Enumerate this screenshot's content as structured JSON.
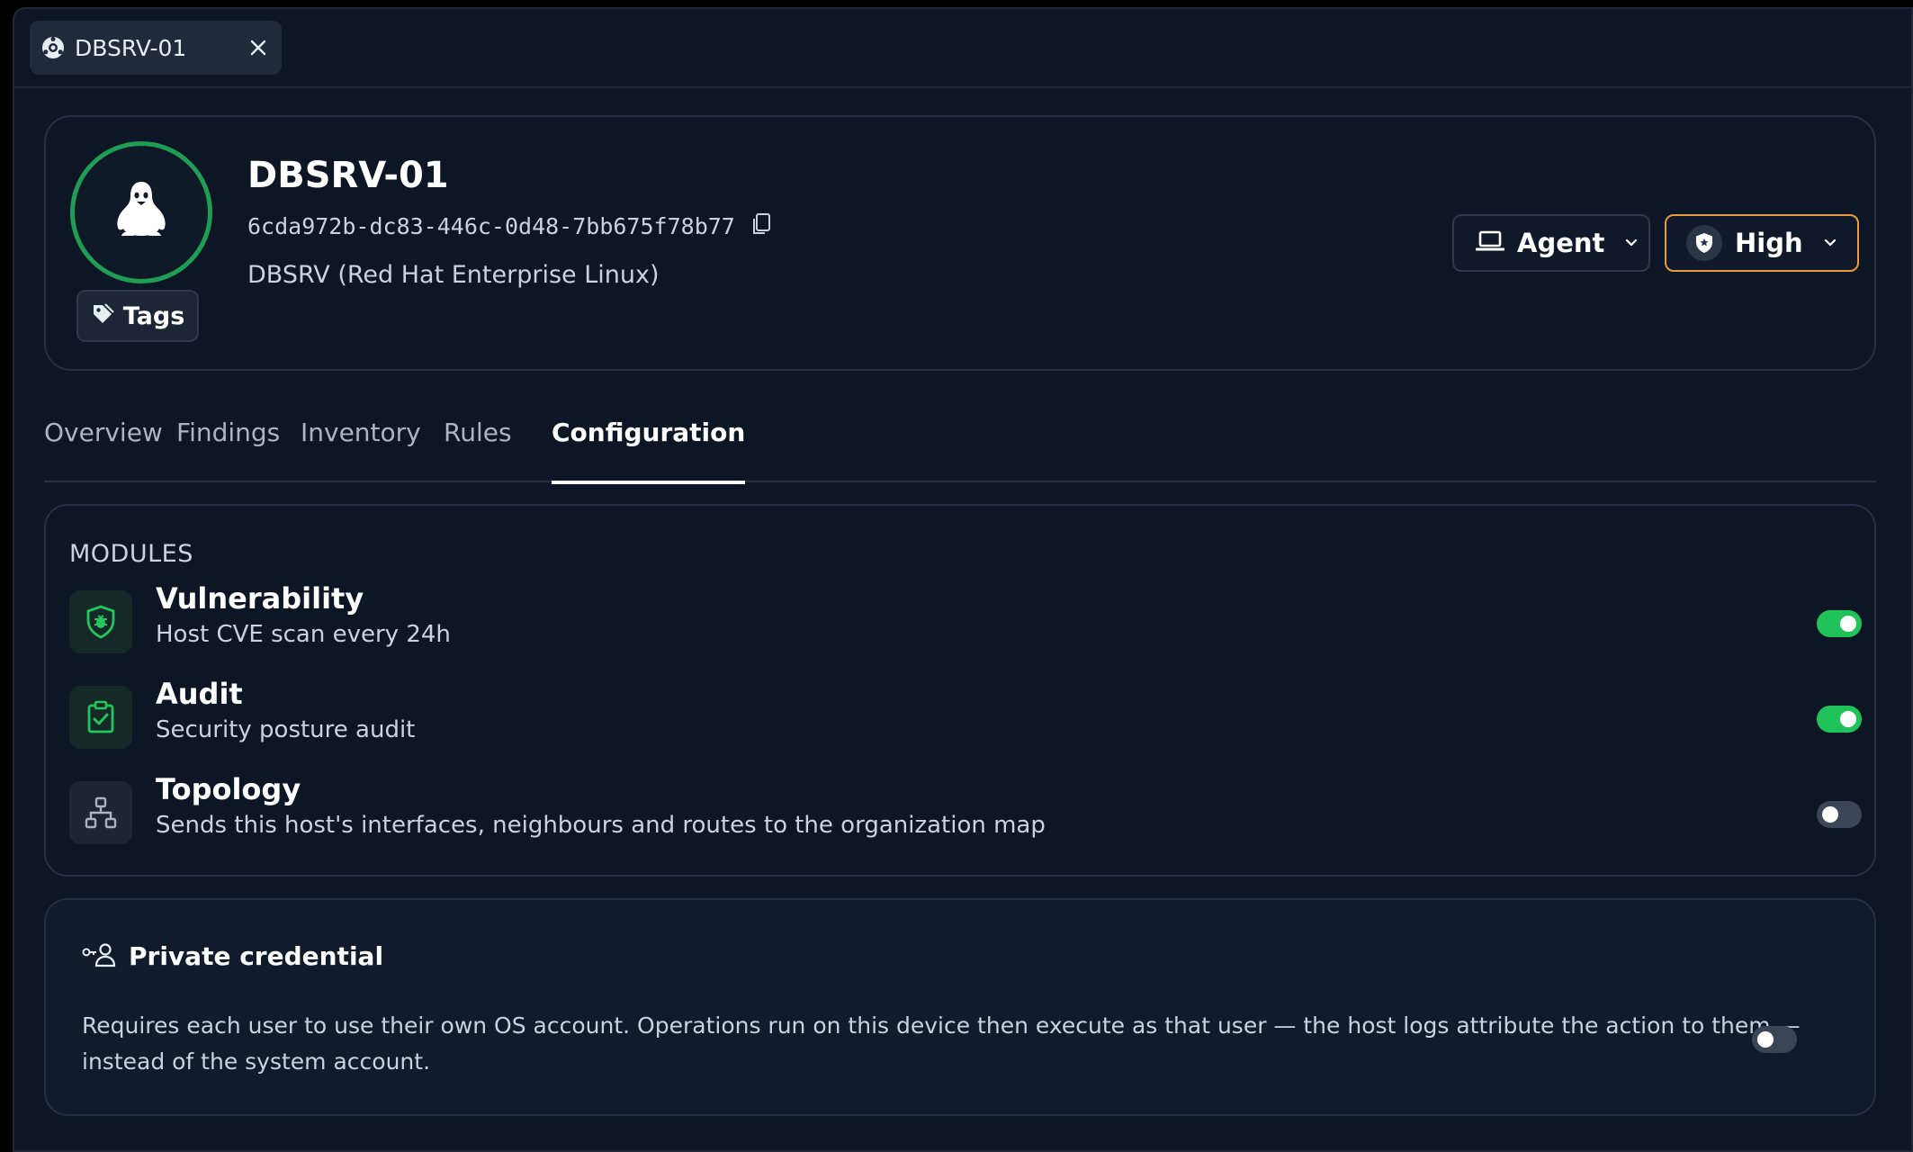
{
  "window_tab": {
    "label": "DBSRV-01",
    "icon": "globe-icon",
    "close_icon": "close-icon"
  },
  "host": {
    "name": "DBSRV-01",
    "id": "6cda972b-dc83-446c-0d48-7bb675f78b77",
    "os": "DBSRV (Red Hat Enterprise Linux)",
    "avatar_icon": "linux-penguin-icon",
    "avatar_ring_color": "#1f9d55"
  },
  "tags_button": {
    "label": "Tags",
    "icon": "tag-icon"
  },
  "agent_dropdown": {
    "label": "Agent",
    "icon": "laptop-icon"
  },
  "criticality_dropdown": {
    "label": "High",
    "icon": "shield-icon",
    "accent": "#e89a3c"
  },
  "nav": {
    "tabs": [
      {
        "label": "Overview",
        "active": false
      },
      {
        "label": "Findings",
        "active": false
      },
      {
        "label": "Inventory",
        "active": false
      },
      {
        "label": "Rules",
        "active": false
      },
      {
        "label": "Configuration",
        "active": true
      }
    ]
  },
  "modules": {
    "section_label": "MODULES",
    "items": [
      {
        "title": "Vulnerability",
        "desc": "Host CVE scan every 24h",
        "icon": "shield-bug-icon",
        "enabled": true
      },
      {
        "title": "Audit",
        "desc": "Security posture audit",
        "icon": "clipboard-check-icon",
        "enabled": true
      },
      {
        "title": "Topology",
        "desc": "Sends this host's interfaces, neighbours and routes to the organization map",
        "icon": "network-icon",
        "enabled": false
      }
    ]
  },
  "credential": {
    "title": "Private credential",
    "icon": "user-key-icon",
    "desc": "Requires each user to use their own OS account. Operations run on this device then execute as that user — the host logs attribute the action to them — instead of the system account.",
    "enabled": false
  },
  "colors": {
    "toggle_on": "#1fc35a",
    "toggle_off": "#3a4556",
    "icon_green": "#22c55e"
  }
}
